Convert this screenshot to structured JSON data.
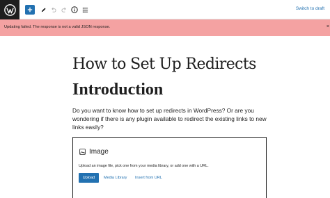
{
  "toolbar": {
    "logo_icon": "wordpress-icon",
    "add_icon": "plus-icon",
    "tools_icon": "pencil-icon",
    "undo_icon": "undo-icon",
    "redo_icon": "redo-icon",
    "details_icon": "info-icon",
    "outline_icon": "list-view-icon",
    "switch_to_draft": "Switch to draft",
    "accent_color": "#2271b1"
  },
  "notice": {
    "text": "Updating failed. The response is not a valid JSON response.",
    "close": "×",
    "background": "#f4a2a2"
  },
  "post": {
    "title": "How to Set Up Redirects",
    "heading": "Introduction",
    "paragraph": "Do you want to know how to set up redirects in WordPress?  Or are you wondering if there is any plugin available to redirect the existing links to new links easily?"
  },
  "image_block": {
    "icon": "image-icon",
    "label": "Image",
    "instructions": "Upload an image file, pick one from your media library, or add one with a URL.",
    "upload_label": "Upload",
    "media_library_label": "Media Library",
    "insert_url_label": "Insert from URL"
  }
}
